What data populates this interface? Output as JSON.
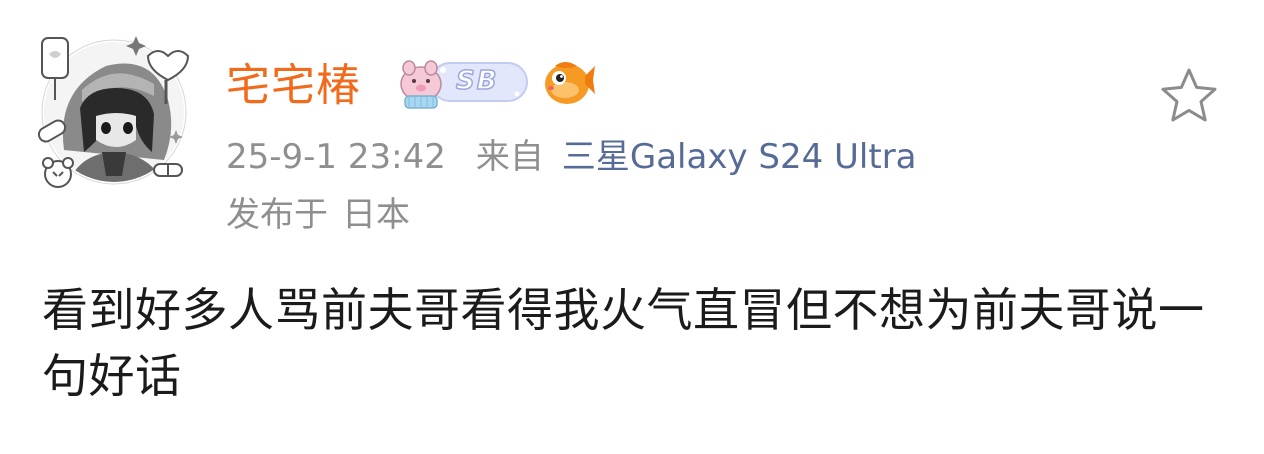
{
  "post": {
    "author": {
      "username": "宅宅椿",
      "member_badge_text": "SB",
      "avatar_icon": "anime-avatar-icon",
      "fish_badge_icon": "goldfish-badge-icon"
    },
    "meta": {
      "time": "25-9-1 23:42",
      "from_label": "来自",
      "device": "三星Galaxy S24 Ultra",
      "location_label": "发布于",
      "location": "日本"
    },
    "body": "看到好多人骂前夫哥看得我火气直冒但不想为前夫哥说一句好话",
    "actions": {
      "favorite_icon": "star-icon"
    }
  },
  "colors": {
    "username": "#f26a1b",
    "meta_text": "#8f8f8f",
    "device_link": "#566b96",
    "body_text": "#1b1b1b",
    "background": "#ffffff"
  }
}
